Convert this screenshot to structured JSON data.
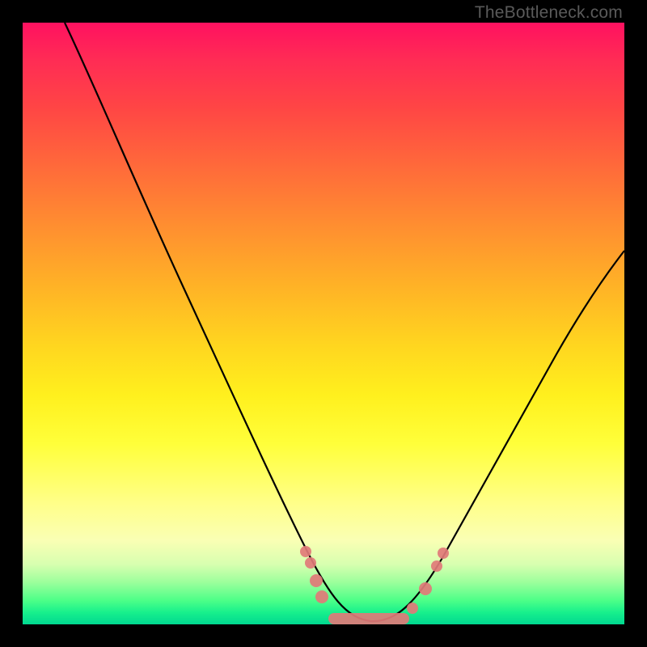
{
  "watermark": "TheBottleneck.com",
  "chart_data": {
    "type": "line",
    "title": "",
    "xlabel": "",
    "ylabel": "",
    "xlim": [
      0,
      100
    ],
    "ylim": [
      0,
      100
    ],
    "gradient_stops": [
      {
        "pos": 0,
        "color": "#ff1160"
      },
      {
        "pos": 14,
        "color": "#ff4545"
      },
      {
        "pos": 34,
        "color": "#ff8f30"
      },
      {
        "pos": 54,
        "color": "#ffd71f"
      },
      {
        "pos": 70,
        "color": "#ffff3a"
      },
      {
        "pos": 86,
        "color": "#faffb4"
      },
      {
        "pos": 96,
        "color": "#4dff88"
      },
      {
        "pos": 100,
        "color": "#00d890"
      }
    ],
    "series": [
      {
        "name": "bottleneck-curve",
        "x": [
          7,
          12,
          18,
          24,
          30,
          36,
          42,
          46,
          50,
          54,
          58,
          62,
          66,
          72,
          78,
          84,
          90,
          96,
          100
        ],
        "y": [
          100,
          89,
          76,
          63,
          50,
          37,
          24,
          14,
          6,
          1,
          0,
          1,
          5,
          14,
          24,
          34,
          44,
          54,
          61
        ]
      }
    ],
    "markers": {
      "name": "highlighted-points",
      "color": "#e57373",
      "points": [
        {
          "x": 47,
          "y": 11
        },
        {
          "x": 48,
          "y": 8
        },
        {
          "x": 49,
          "y": 5
        },
        {
          "x": 52,
          "y": 1.5
        },
        {
          "x": 58,
          "y": 0
        },
        {
          "x": 63,
          "y": 1.5
        },
        {
          "x": 66,
          "y": 5
        },
        {
          "x": 69,
          "y": 10
        },
        {
          "x": 70,
          "y": 12
        }
      ],
      "bar": {
        "x1": 51,
        "x2": 64,
        "y": 0
      }
    }
  }
}
